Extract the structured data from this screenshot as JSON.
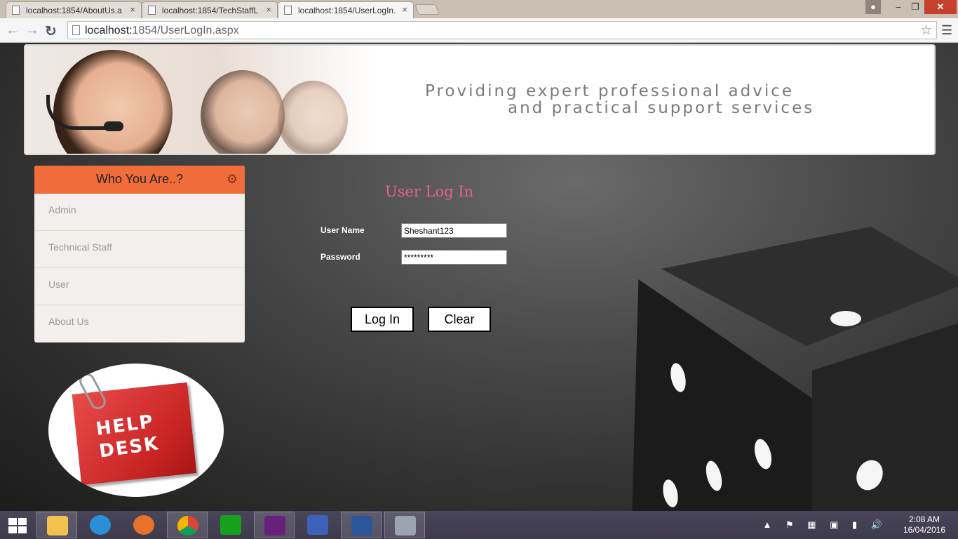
{
  "browser": {
    "tabs": [
      {
        "title": "localhost:1854/AboutUs.a",
        "close": "×"
      },
      {
        "title": "localhost:1854/TechStaffL",
        "close": "×"
      },
      {
        "title": "localhost:1854/UserLogIn.",
        "close": "×"
      }
    ],
    "url_host": "localhost:",
    "url_path": "1854/UserLogIn.aspx"
  },
  "banner": {
    "line1": "Providing expert professional advice",
    "line2": "and practical support services"
  },
  "sidebar": {
    "title": "Who You Are..?",
    "items": [
      {
        "label": "Admin"
      },
      {
        "label": "Technical Staff"
      },
      {
        "label": "User"
      },
      {
        "label": "About Us"
      }
    ]
  },
  "helpdesk": {
    "line1": "HELP",
    "line2": "DESK"
  },
  "login": {
    "title": "User Log In",
    "username_label": "User Name",
    "username_value": "Sheshant123",
    "password_label": "Password",
    "password_value": "*********",
    "login_button": "Log In",
    "clear_button": "Clear"
  },
  "taskbar": {
    "time": "2:08 AM",
    "date": "16/04/2016",
    "apps": [
      "file-explorer-icon",
      "internet-explorer-icon",
      "firefox-icon",
      "chrome-icon",
      "store-icon",
      "visual-studio-icon",
      "visio-icon",
      "word-icon",
      "media-tool-icon"
    ]
  },
  "colors": {
    "sidebar_header": "#f06c3b",
    "login_title": "#e8628a"
  }
}
